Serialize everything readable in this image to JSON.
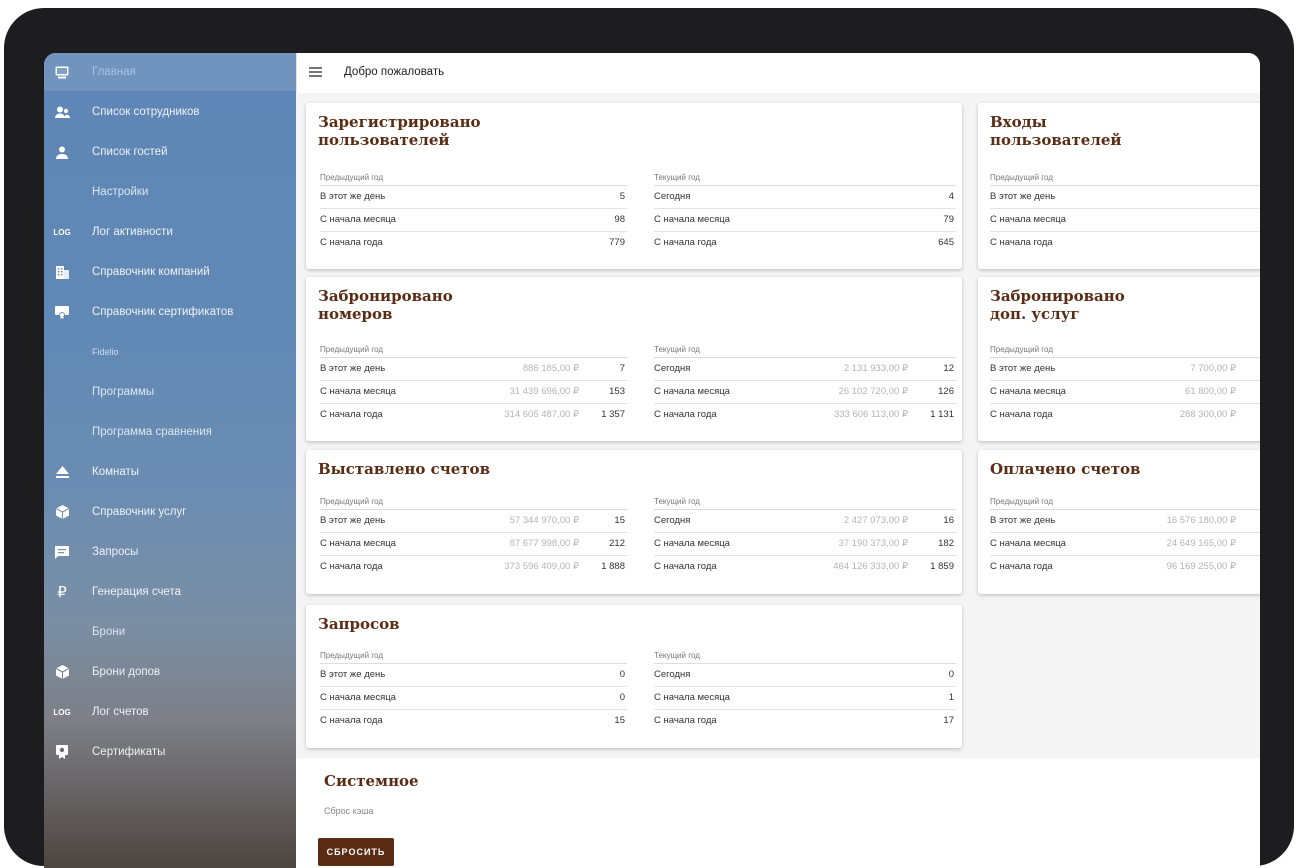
{
  "topbar": {
    "title": "Добро пожаловать"
  },
  "sidebar": {
    "items": [
      {
        "label": "Главная",
        "icon": "monitor-icon"
      },
      {
        "label": "Список сотрудников",
        "icon": "people-icon"
      },
      {
        "label": "Список гостей",
        "icon": "person-icon"
      },
      {
        "label": "Настройки",
        "icon": ""
      },
      {
        "label": "Лог активности",
        "icon": "log-icon",
        "icon_text": "LOG"
      },
      {
        "label": "Справочник компаний",
        "icon": "building-icon"
      },
      {
        "label": "Справочник сертификатов",
        "icon": "certificate-icon"
      },
      {
        "label": "Fidelio",
        "icon": ""
      },
      {
        "label": "Программы",
        "icon": ""
      },
      {
        "label": "Программа сравнения",
        "icon": ""
      },
      {
        "label": "Комнаты",
        "icon": "eject-icon"
      },
      {
        "label": "Справочник услуг",
        "icon": "cube-icon"
      },
      {
        "label": "Запросы",
        "icon": "chat-icon"
      },
      {
        "label": "Генерация счета",
        "icon": "ruble-icon",
        "icon_text": "₽"
      },
      {
        "label": "Брони",
        "icon": ""
      },
      {
        "label": "Брони допов",
        "icon": "cube-icon"
      },
      {
        "label": "Лог счетов",
        "icon": "log-icon",
        "icon_text": "LOG"
      },
      {
        "label": "Сертификаты",
        "icon": "voucher-icon"
      }
    ]
  },
  "cards": {
    "registered": {
      "title_1": "Зарегистрировано",
      "title_2": "пользователей",
      "prev_head": "Предыдущий год",
      "cur_head": "Текущий год",
      "prev": [
        {
          "label": "В этот же день",
          "count": "5"
        },
        {
          "label": "С начала месяца",
          "count": "98"
        },
        {
          "label": "С начала года",
          "count": "779"
        }
      ],
      "cur": [
        {
          "label": "Сегодня",
          "count": "4"
        },
        {
          "label": "С начала месяца",
          "count": "79"
        },
        {
          "label": "С начала года",
          "count": "645"
        }
      ]
    },
    "logins": {
      "title_1": "Входы",
      "title_2": "пользователей",
      "prev_head": "Предыдущий год",
      "prev": [
        {
          "label": "В этот же день"
        },
        {
          "label": "С начала месяца"
        },
        {
          "label": "С начала года"
        }
      ]
    },
    "rooms": {
      "title_1": "Забронировано",
      "title_2": "номеров",
      "prev_head": "Предыдущий год",
      "cur_head": "Текущий год",
      "prev": [
        {
          "label": "В этот же день",
          "amount": "886 185,00 ₽",
          "count": "7"
        },
        {
          "label": "С начала месяца",
          "amount": "31 439 696,00 ₽",
          "count": "153"
        },
        {
          "label": "С начала года",
          "amount": "314 605 487,00 ₽",
          "count": "1 357"
        }
      ],
      "cur": [
        {
          "label": "Сегодня",
          "amount": "2 131 933,00 ₽",
          "count": "12"
        },
        {
          "label": "С начала месяца",
          "amount": "26 102 720,00 ₽",
          "count": "126"
        },
        {
          "label": "С начала года",
          "amount": "333 606 113,00 ₽",
          "count": "1 131"
        }
      ]
    },
    "extras": {
      "title_1": "Забронировано",
      "title_2": "доп. услуг",
      "prev_head": "Предыдущий год",
      "prev": [
        {
          "label": "В этот же день",
          "amount": "7 700,00 ₽"
        },
        {
          "label": "С начала месяца",
          "amount": "61 800,00 ₽"
        },
        {
          "label": "С начала года",
          "amount": "288 300,00 ₽"
        }
      ]
    },
    "invoices": {
      "title_1": "Выставлено счетов",
      "prev_head": "Предыдущий год",
      "cur_head": "Текущий год",
      "prev": [
        {
          "label": "В этот же день",
          "amount": "57 344 970,00 ₽",
          "count": "15"
        },
        {
          "label": "С начала месяца",
          "amount": "87 677 998,00 ₽",
          "count": "212"
        },
        {
          "label": "С начала года",
          "amount": "373 596 409,00 ₽",
          "count": "1 888"
        }
      ],
      "cur": [
        {
          "label": "Сегодня",
          "amount": "2 427 073,00 ₽",
          "count": "16"
        },
        {
          "label": "С начала месяца",
          "amount": "37 190 373,00 ₽",
          "count": "182"
        },
        {
          "label": "С начала года",
          "amount": "464 126 333,00 ₽",
          "count": "1 859"
        }
      ]
    },
    "paid": {
      "title_1": "Оплачено счетов",
      "prev_head": "Предыдущий год",
      "prev": [
        {
          "label": "В этот же день",
          "amount": "16 576 180,00 ₽"
        },
        {
          "label": "С начала месяца",
          "amount": "24 649 165,00 ₽"
        },
        {
          "label": "С начала года",
          "amount": "96 169 255,00 ₽"
        }
      ]
    },
    "requests": {
      "title_1": "Запросов",
      "prev_head": "Предыдущий год",
      "cur_head": "Текущий год",
      "prev": [
        {
          "label": "В этот же день",
          "count": "0"
        },
        {
          "label": "С начала месяца",
          "count": "0"
        },
        {
          "label": "С начала года",
          "count": "15"
        }
      ],
      "cur": [
        {
          "label": "Сегодня",
          "count": "0"
        },
        {
          "label": "С начала месяца",
          "count": "1"
        },
        {
          "label": "С начала года",
          "count": "17"
        }
      ]
    }
  },
  "system": {
    "title": "Системное",
    "subtitle": "Сброс кэша",
    "reset_label": "СБРОСИТЬ"
  },
  "colors": {
    "accent": "#5a2c14",
    "sidebar": "#6189b5",
    "device": "#1d1d1f"
  }
}
